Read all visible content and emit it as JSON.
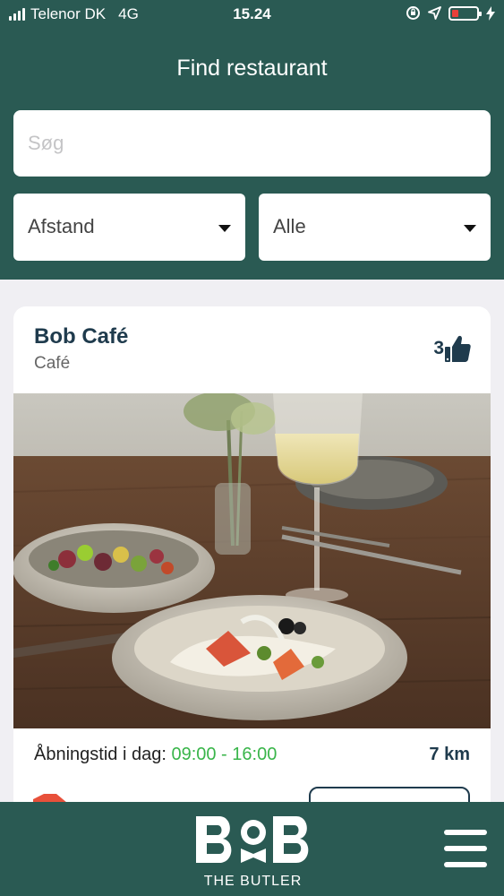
{
  "status": {
    "carrier": "Telenor DK",
    "network": "4G",
    "time": "15.24"
  },
  "header": {
    "title": "Find restaurant",
    "search_placeholder": "Søg",
    "filter_distance": "Afstand",
    "filter_category": "Alle"
  },
  "restaurant": {
    "name": "Bob Café",
    "type": "Café",
    "likes": "3",
    "opening_label": "Åbningstid i dag:",
    "opening_hours": "09:00 - 16:00",
    "distance": "7 km"
  },
  "footer": {
    "brand_sub": "THE BUTLER"
  },
  "colors": {
    "primary": "#2a5a53",
    "navy": "#1f3b4d",
    "open_green": "#39b54a",
    "battery_low": "#e8403a"
  },
  "icons": [
    "signal-icon",
    "rotation-lock-icon",
    "location-arrow-icon",
    "battery-icon",
    "charging-icon",
    "thumbs-up-icon",
    "chevron-down-icon",
    "tag-icon",
    "hamburger-menu-icon"
  ]
}
